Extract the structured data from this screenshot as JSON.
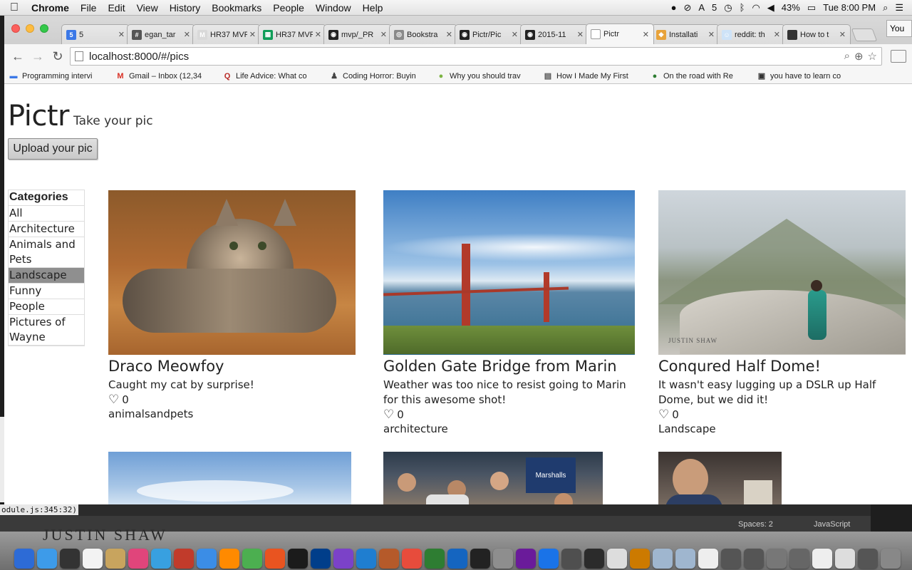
{
  "menubar": {
    "app": "Chrome",
    "items": [
      "File",
      "Edit",
      "View",
      "History",
      "Bookmarks",
      "People",
      "Window",
      "Help"
    ],
    "status": {
      "adobe_count": "5",
      "battery": "43%",
      "clock": "Tue 8:00 PM"
    }
  },
  "tabs": [
    {
      "label": "5",
      "fav_color": "#3b78e7",
      "fav_glyph": "5"
    },
    {
      "label": "egan_tar",
      "fav_color": "#555555",
      "fav_glyph": "#"
    },
    {
      "label": "HR37 MVP",
      "fav_color": "#d9d9d9",
      "fav_glyph": "M"
    },
    {
      "label": "HR37 MVP",
      "fav_color": "#0f9d58",
      "fav_glyph": "▦"
    },
    {
      "label": "mvp/_PR",
      "fav_color": "#222222",
      "fav_glyph": "◉"
    },
    {
      "label": "Bookstra",
      "fav_color": "#8a8a8a",
      "fav_glyph": "◎"
    },
    {
      "label": "Pictr/Pic",
      "fav_color": "#222222",
      "fav_glyph": "◉"
    },
    {
      "label": "2015-11",
      "fav_color": "#222222",
      "fav_glyph": "◉"
    },
    {
      "label": "Pictr",
      "fav_color": "#ffffff",
      "fav_glyph": "",
      "active": true
    },
    {
      "label": "Installati",
      "fav_color": "#e8a33b",
      "fav_glyph": "◆"
    },
    {
      "label": "reddit: th",
      "fav_color": "#cee3f8",
      "fav_glyph": "☺"
    },
    {
      "label": "How to t",
      "fav_color": "#333333",
      "fav_glyph": ""
    }
  ],
  "profile_label": "You",
  "address_bar": {
    "url": "localhost:8000/#/pics"
  },
  "bookmarks": [
    {
      "label": "Programming intervi",
      "icon": "folder"
    },
    {
      "label": "Gmail – Inbox (12,34",
      "icon": "M"
    },
    {
      "label": "Life Advice: What co",
      "icon": "Q"
    },
    {
      "label": "Coding Horror: Buyin",
      "icon": "CH"
    },
    {
      "label": "Why you should trav",
      "icon": "leaf"
    },
    {
      "label": "How I Made My First",
      "icon": "EH"
    },
    {
      "label": "On the road with Re",
      "icon": "dot"
    },
    {
      "label": "you have to learn co",
      "icon": "img"
    }
  ],
  "site": {
    "title": "Pictr",
    "tagline": "Take your pic",
    "upload_label": "Upload your pic"
  },
  "categories": {
    "header": "Categories",
    "items": [
      {
        "label": "All",
        "active": false
      },
      {
        "label": "Architecture",
        "active": false
      },
      {
        "label": "Animals and Pets",
        "active": false
      },
      {
        "label": "Landscape",
        "active": true
      },
      {
        "label": "Funny",
        "active": false
      },
      {
        "label": "People",
        "active": false
      },
      {
        "label": "Pictures of Wayne",
        "active": false
      }
    ]
  },
  "pics": [
    {
      "title": "Draco Meowfoy",
      "description": "Caught my cat by surprise!",
      "likes": "0",
      "category": "animalsandpets",
      "image": "cat-photo"
    },
    {
      "title": "Golden Gate Bridge from Marin",
      "description": "Weather was too nice to resist going to Marin for this awesome shot!",
      "likes": "0",
      "category": "architecture",
      "image": "bridge-photo"
    },
    {
      "title": "Conqured Half Dome!",
      "description": "It wasn't easy lugging up a DSLR up Half Dome, but we did it!",
      "likes": "0",
      "category": "Landscape",
      "image": "mountain-photo",
      "watermark": "JUSTIN SHAW"
    },
    {
      "image": "sky-photo"
    },
    {
      "image": "crowd-photo",
      "sign": "Marshalls"
    },
    {
      "image": "person-photo"
    }
  ],
  "editor": {
    "spaces": "Spaces: 2",
    "language": "JavaScript",
    "terminal_line": "odule.js:345:32)"
  },
  "dock_watermark": "JUSTIN SHAW"
}
